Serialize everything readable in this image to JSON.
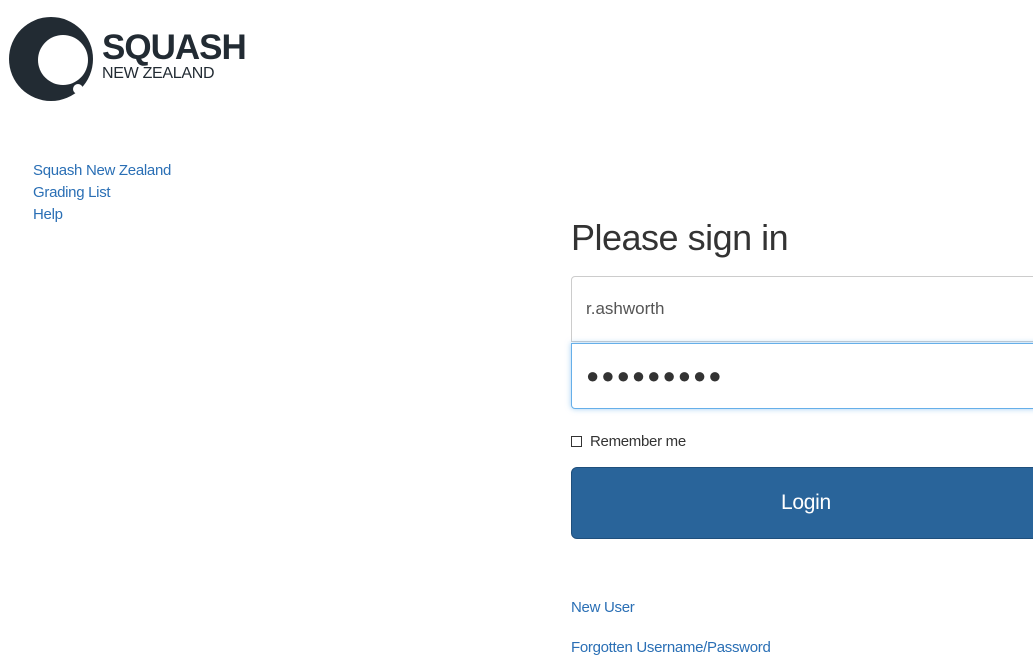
{
  "brand": {
    "title": "SQUASH",
    "subtitle": "NEW ZEALAND",
    "colors": {
      "logo_dark": "#222b33",
      "link": "#2a6fb5",
      "button": "#29649a",
      "focus": "#66afe9"
    }
  },
  "sidebar": {
    "items": [
      {
        "label": "Squash New Zealand"
      },
      {
        "label": "Grading List"
      },
      {
        "label": "Help"
      }
    ]
  },
  "signin": {
    "heading": "Please sign in",
    "username_value": "r.ashworth",
    "password_value": "●●●●●●●●●",
    "remember_label": "Remember me",
    "remember_checked": false,
    "login_label": "Login"
  },
  "footer_links": {
    "new_user": "New User",
    "forgotten": "Forgotten Username/Password"
  }
}
